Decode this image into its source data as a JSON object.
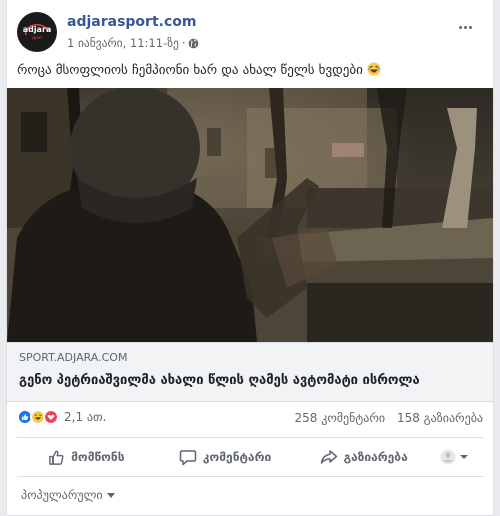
{
  "post": {
    "page_name": "adjarasport.com",
    "timestamp": "1 იანვარი, 11:11-ზე",
    "privacy_icon": "globe-icon",
    "text": "როცა მსოფლიოს ჩემპიონი ხარ და ახალ წელს ხვდები",
    "text_emoji": "laughing-face"
  },
  "avatar": {
    "logo_text": "adjara",
    "logo_sub": "sport"
  },
  "link": {
    "domain": "SPORT.ADJARA.COM",
    "title": "გენო პეტრიაშვილმა ახალი წლის ღამეს ავტომატი ისროლა"
  },
  "stats": {
    "reactions": [
      "like",
      "haha",
      "love"
    ],
    "reaction_count": "2,1 ათ.",
    "comments": "258 კომენტარი",
    "shares": "158 გაზიარება"
  },
  "actions": {
    "like": "მომწონს",
    "comment": "კომენტარი",
    "share": "გაზიარება"
  },
  "sort": {
    "label": "პოპულარული"
  },
  "colors": {
    "link_blue": "#365899",
    "like_blue": "#1877f2",
    "love_red": "#f33e58",
    "haha_yellow": "#f7c94c"
  }
}
